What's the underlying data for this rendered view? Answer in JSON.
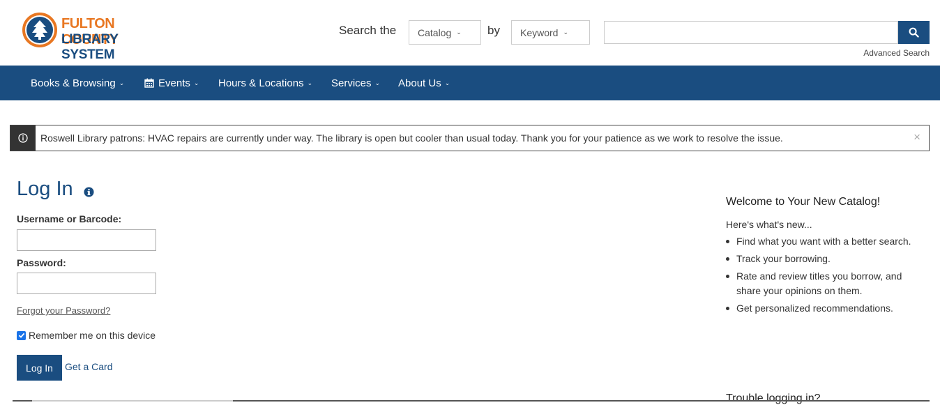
{
  "logo": {
    "line1": "FULTON COUNTY",
    "line2": "LIBRARY SYSTEM"
  },
  "search": {
    "label": "Search the",
    "scope": "Catalog",
    "by_label": "by",
    "type": "Keyword",
    "value": "",
    "advanced": "Advanced Search"
  },
  "nav": {
    "items": [
      {
        "label": "Books & Browsing"
      },
      {
        "label": "Events"
      },
      {
        "label": "Hours & Locations"
      },
      {
        "label": "Services"
      },
      {
        "label": "About Us"
      }
    ]
  },
  "alert": {
    "text": "Roswell Library patrons: HVAC repairs are currently under way. The library is open but cooler than usual today. Thank you for your patience as we work to resolve the issue.",
    "close": "×"
  },
  "login": {
    "title": "Log In",
    "username_label": "Username or Barcode:",
    "username_value": "",
    "password_label": "Password:",
    "password_value": "",
    "forgot": "Forgot your Password?",
    "remember": "Remember me on this device",
    "remember_checked": true,
    "submit": "Log In",
    "get_card": "Get a Card"
  },
  "sidebar": {
    "title": "Welcome to Your New Catalog!",
    "intro": "Here's what's new...",
    "items": [
      {
        "text": "Find what you want with a better search."
      },
      {
        "text": "Track your borrowing."
      },
      {
        "text": "Rate and review titles you borrow, and share your opinions on them."
      },
      {
        "text": "Get personalized recommendations."
      }
    ],
    "trouble": "Trouble logging in?"
  },
  "colors": {
    "brand_blue": "#1a4d80",
    "brand_orange": "#e87722"
  }
}
